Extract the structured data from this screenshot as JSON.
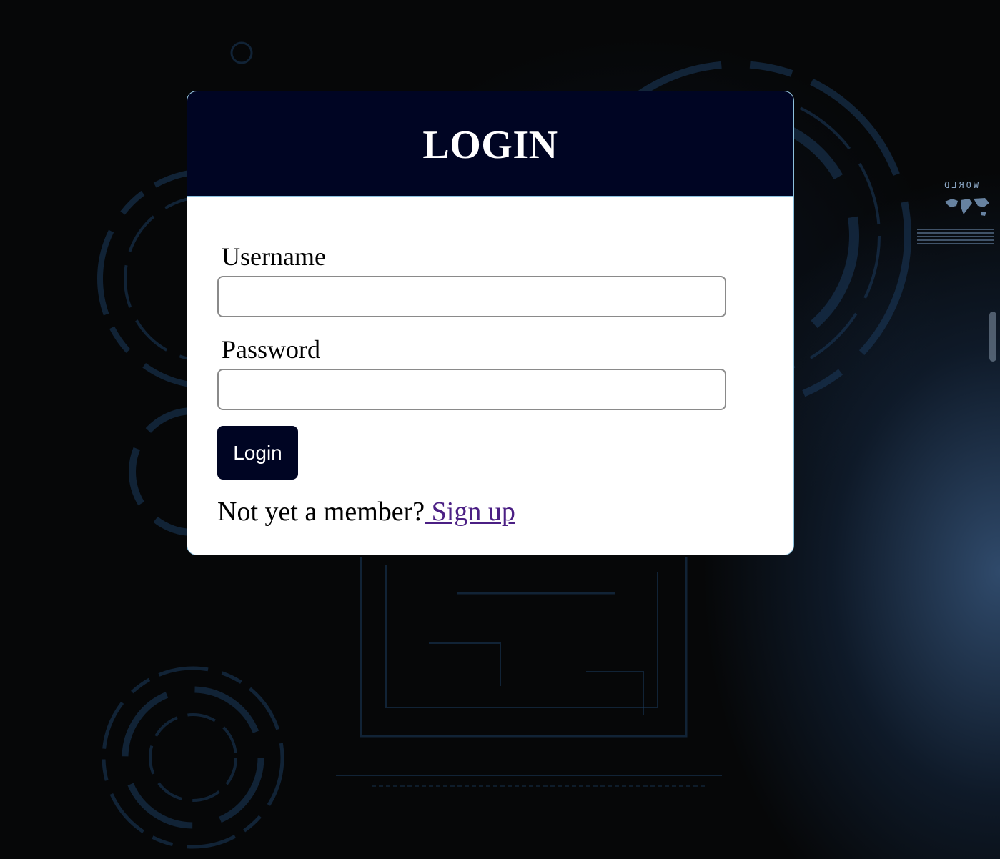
{
  "page": {
    "background_colors": {
      "base": "#060708",
      "glow": "#466ea0",
      "accent_lines": "#1c3a5c"
    },
    "card": {
      "title": "LOGIN",
      "header_color": "#000523",
      "border_color": "#8cc0dc"
    },
    "form": {
      "username_label": "Username",
      "username_value": "",
      "password_label": "Password",
      "password_value": "",
      "login_button_label": "Login",
      "member_prompt": "Not yet a member?",
      "signup_link_label": " Sign up",
      "signup_link_color": "#4b1f84"
    },
    "background_badge": {
      "text": "WORLD",
      "icon": "world-map-icon"
    }
  }
}
